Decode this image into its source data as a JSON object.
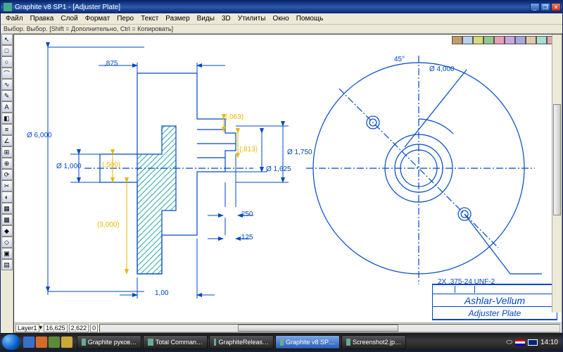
{
  "title": "Graphite v8 SP1 - [Adjuster Plate]",
  "menu": [
    "Файл",
    "Правка",
    "Слой",
    "Формат",
    "Перо",
    "Текст",
    "Размер",
    "Виды",
    "3D",
    "Утилиты",
    "Окно",
    "Помощь"
  ],
  "hint": "Выбор. Выбор. [Shift = Дополнительно, Ctrl = Копировать]",
  "palette": [
    "#c49a6c",
    "#b5d4e8",
    "#d9d97a",
    "#8fc98f",
    "#e8a0b5",
    "#c8a8e0",
    "#a8a8e0",
    "#e0c8a8",
    "#a8e0d0",
    "#e0a8a8"
  ],
  "dims": {
    "d875": ",875",
    "d6000": "Ø 6,000",
    "d1000": "Ø 1,000",
    "d500": "(,500)",
    "d3000": "(3,000)",
    "d063": "(,063)",
    "d813": "(,813)",
    "d1750": "Ø 1,750",
    "d1625": "Ø 1,625",
    "d250": ",250",
    "d125": ",125",
    "d100": "1,00",
    "d45": "45°",
    "d4000": "Ø 4,000",
    "thread": "2X ,375-24 UNF-2"
  },
  "titleblock": {
    "brand": "Ashlar-Vellum",
    "part": "Adjuster Plate"
  },
  "status": {
    "layer": "Layer1",
    "x": "16,625",
    "y": "2,622",
    "z": "0"
  },
  "tasks": [
    {
      "label": "Graphite руков…",
      "active": false
    },
    {
      "label": "Total Comman…",
      "active": false
    },
    {
      "label": "GraphiteReleas…",
      "active": false
    },
    {
      "label": "Graphite v8 SP…",
      "active": true
    },
    {
      "label": "Screenshot2.jp…",
      "active": false
    }
  ],
  "clock": "14:10",
  "tools": [
    "↖",
    "□",
    "○",
    "⌒",
    "∿",
    "✎",
    "A",
    "◧",
    "≡",
    "∠",
    "⊞",
    "⊕",
    "⟳",
    "✂",
    "◐",
    "▦",
    "▩",
    "◆",
    "◇",
    "▣",
    "▤"
  ]
}
